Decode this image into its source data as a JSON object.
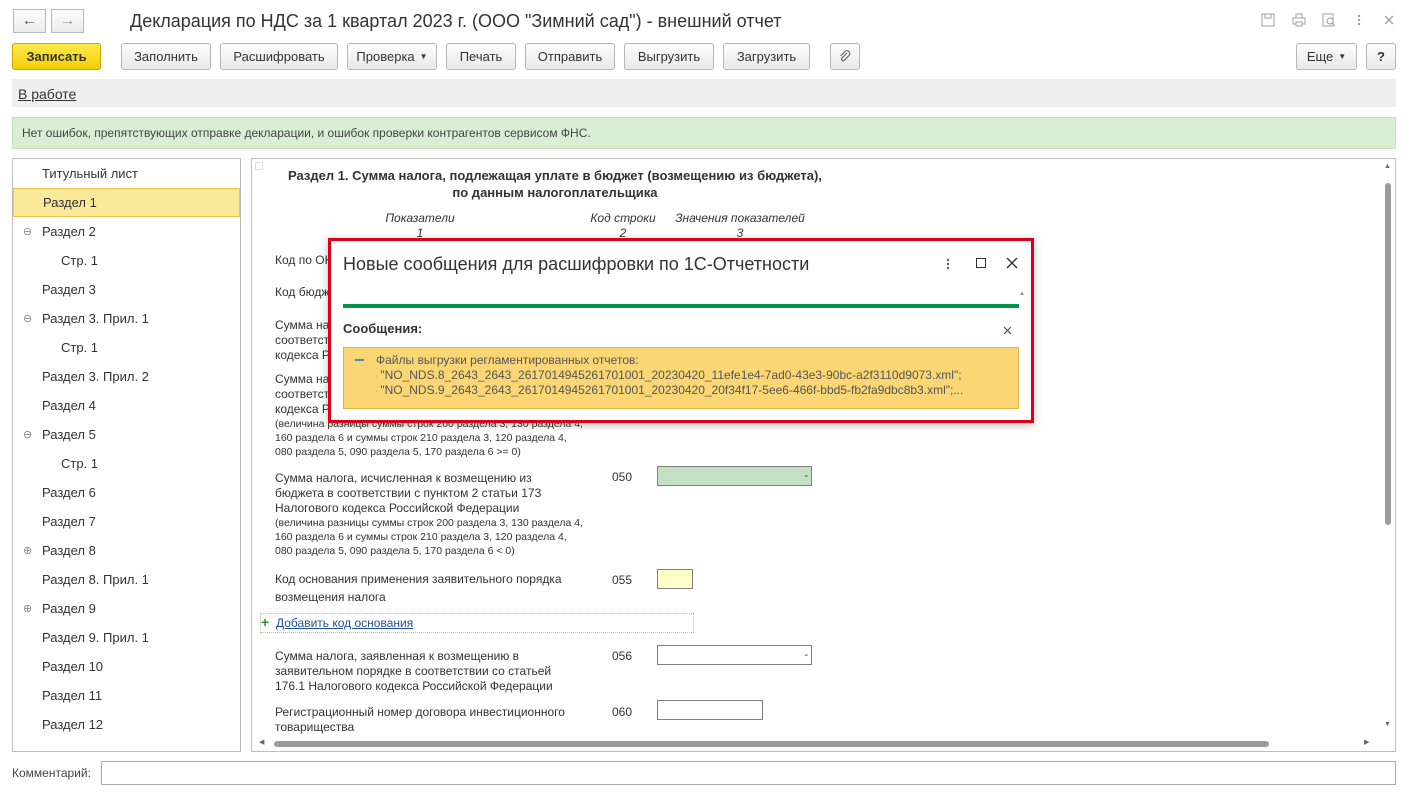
{
  "window": {
    "title": "Декларация по НДС за 1 квартал 2023 г. (ООО \"Зимний сад\") - внешний отчет",
    "nav_back": "←",
    "nav_forward": "→"
  },
  "toolbar": {
    "save": "Записать",
    "fill": "Заполнить",
    "decode": "Расшифровать",
    "check": "Проверка",
    "print": "Печать",
    "send": "Отправить",
    "upload": "Выгрузить",
    "download": "Загрузить",
    "more": "Еще",
    "help": "?"
  },
  "status_link": "В работе",
  "info_message": "Нет ошибок, препятствующих отправке декларации, и ошибок проверки контрагентов сервисом ФНС.",
  "sidebar": {
    "items": [
      {
        "label": "Титульный лист",
        "toggle": ""
      },
      {
        "label": "Раздел 1",
        "toggle": ""
      },
      {
        "label": "Раздел 2",
        "toggle": "⊖"
      },
      {
        "label": "Стр. 1",
        "toggle": ""
      },
      {
        "label": "Раздел 3",
        "toggle": ""
      },
      {
        "label": "Раздел 3. Прил. 1",
        "toggle": "⊖"
      },
      {
        "label": "Стр. 1",
        "toggle": ""
      },
      {
        "label": "Раздел 3. Прил. 2",
        "toggle": ""
      },
      {
        "label": "Раздел 4",
        "toggle": ""
      },
      {
        "label": "Раздел 5",
        "toggle": "⊖"
      },
      {
        "label": "Стр. 1",
        "toggle": ""
      },
      {
        "label": "Раздел 6",
        "toggle": ""
      },
      {
        "label": "Раздел 7",
        "toggle": ""
      },
      {
        "label": "Раздел 8",
        "toggle": "⊕"
      },
      {
        "label": "Раздел 8. Прил. 1",
        "toggle": ""
      },
      {
        "label": "Раздел 9",
        "toggle": "⊕"
      },
      {
        "label": "Раздел 9. Прил. 1",
        "toggle": ""
      },
      {
        "label": "Раздел 10",
        "toggle": ""
      },
      {
        "label": "Раздел 11",
        "toggle": ""
      },
      {
        "label": "Раздел 12",
        "toggle": ""
      }
    ]
  },
  "form": {
    "title_line1": "Раздел 1. Сумма налога, подлежащая уплате в бюджет (возмещению из бюджета),",
    "title_line2": "по данным налогоплательщика",
    "col1": "Показатели",
    "col1_num": "1",
    "col2": "Код строки",
    "col2_num": "2",
    "col3": "Значения показателей",
    "col3_num": "3",
    "row_okato": "Код по ОК",
    "row_kbk": "Код бюдж",
    "row_040_l1": "Сумма на",
    "row_040_l2": "соответст",
    "row_040_l3": "кодекса Р",
    "row_040b_l1": "Сумма на",
    "row_040b_l2": "соответст",
    "row_040b_l3": "кодекса Р",
    "row_040b_note1": "(величина разницы суммы строк 200 раздела 3, 130 раздела 4,",
    "row_040b_note2": "160 раздела 6 и суммы строк 210 раздела 3, 120 раздела 4,",
    "row_040b_note3": "080 раздела 5, 090 раздела 5, 170 раздела 6 >= 0)",
    "row_050_l1": "Сумма налога, исчисленная к возмещению из",
    "row_050_l2": "бюджета в соответствии с пунктом 2 статьи 173",
    "row_050_l3": "Налогового кодекса Российской Федерации",
    "row_050_note1": "(величина разницы суммы строк 200 раздела 3, 130 раздела 4,",
    "row_050_note2": "160 раздела 6 и суммы строк 210 раздела 3, 120 раздела 4,",
    "row_050_note3": "080 раздела 5, 090 раздела 5, 170 раздела 6 < 0)",
    "code_050": "050",
    "val_050": "-",
    "row_055_l1": "Код основания применения заявительного порядка",
    "row_055_l2": "возмещения налога",
    "code_055": "055",
    "add_basis": "Добавить код основания",
    "row_056_l1": "Сумма налога, заявленная к возмещению в",
    "row_056_l2": "заявительном порядке в соответствии со статьей",
    "row_056_l3": "176.1 Налогового кодекса Российской Федерации",
    "code_056": "056",
    "val_056": "-",
    "row_060_l1": "Регистрационный номер договора инвестиционного",
    "row_060_l2": "товарищества",
    "code_060": "060"
  },
  "dialog": {
    "title": "Новые сообщения для расшифровки по 1С-Отчетности",
    "section": "Сообщения:",
    "msg_line1": "Файлы выгрузки регламентированных отчетов:",
    "msg_line2": "- \"NO_NDS.8_2643_2643_2617014945261701001_20230420_11efe1e4-7ad0-43e3-90bc-a2f3110d9073.xml\";",
    "msg_line3": "- \"NO_NDS.9_2643_2643_2617014945261701001_20230420_20f34f17-5ee6-466f-bbd5-fb2fa9dbc8b3.xml\";...",
    "accent": "#009646",
    "highlight_border": "#d9001b"
  },
  "comment_label": "Комментарий:"
}
